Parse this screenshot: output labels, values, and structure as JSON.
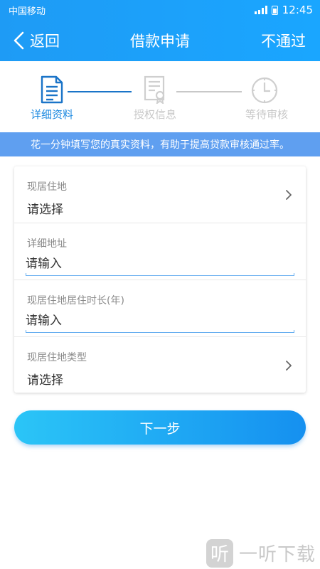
{
  "status_bar": {
    "carrier": "中国移动",
    "time": "12:45"
  },
  "nav": {
    "back_label": "返回",
    "title": "借款申请",
    "right_label": "不通过"
  },
  "steps": [
    {
      "label": "详细资料",
      "icon": "document-icon",
      "state": "active"
    },
    {
      "label": "授权信息",
      "icon": "certificate-icon",
      "state": "inactive"
    },
    {
      "label": "等待审核",
      "icon": "clock-icon",
      "state": "inactive"
    }
  ],
  "notice": "花一分钟填写您的真实资料，有助于提高贷款审核通过率。",
  "form": {
    "rows": [
      {
        "label": "现居住地",
        "type": "select",
        "value": "请选择"
      },
      {
        "label": "详细地址",
        "type": "input",
        "placeholder": "请输入"
      },
      {
        "label": "现居住地居住时长(年)",
        "type": "input",
        "placeholder": "请输入"
      },
      {
        "label": "现居住地类型",
        "type": "select",
        "value": "请选择"
      }
    ]
  },
  "next_button": "下一步",
  "watermark": {
    "logo_char": "听",
    "text": "一听下载"
  },
  "colors": {
    "primary": "#1e9bf5",
    "active_step": "#1a74c8",
    "inactive_step": "#d0d0d0",
    "notice_bg": "#5f9ff0"
  }
}
